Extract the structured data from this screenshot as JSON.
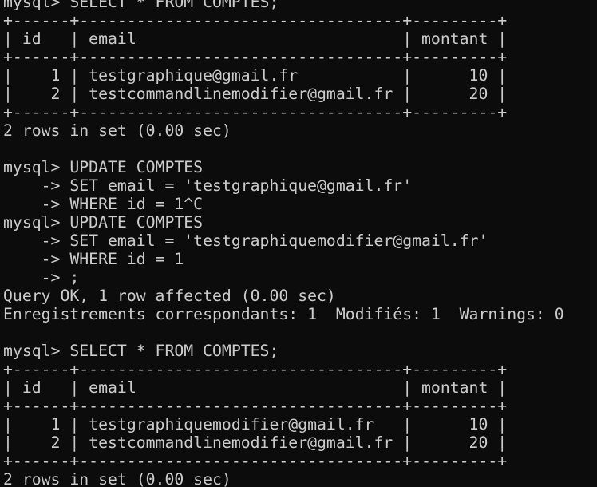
{
  "terminal": {
    "lines": [
      "mysql> SELECT * FROM COMPTES;",
      "+------+----------------------------------+---------+",
      "| id   | email                            | montant |",
      "+------+----------------------------------+---------+",
      "|    1 | testgraphique@gmail.fr           |      10 |",
      "|    2 | testcommandlinemodifier@gmail.fr |      20 |",
      "+------+----------------------------------+---------+",
      "2 rows in set (0.00 sec)",
      "",
      "mysql> UPDATE COMPTES",
      "    -> SET email = 'testgraphique@gmail.fr'",
      "    -> WHERE id = 1^C",
      "mysql> UPDATE COMPTES",
      "    -> SET email = 'testgraphiquemodifier@gmail.fr'",
      "    -> WHERE id = 1",
      "    -> ;",
      "Query OK, 1 row affected (0.00 sec)",
      "Enregistrements correspondants: 1  Modifiés: 1  Warnings: 0",
      "",
      "mysql> SELECT * FROM COMPTES;",
      "+------+----------------------------------+---------+",
      "| id   | email                            | montant |",
      "+------+----------------------------------+---------+",
      "|    1 | testgraphiquemodifier@gmail.fr   |      10 |",
      "|    2 | testcommandlinemodifier@gmail.fr |      20 |",
      "+------+----------------------------------+---------+",
      "2 rows in set (0.00 sec)"
    ]
  },
  "colors": {
    "background": "#0c0c0c",
    "text": "#cccccc"
  }
}
